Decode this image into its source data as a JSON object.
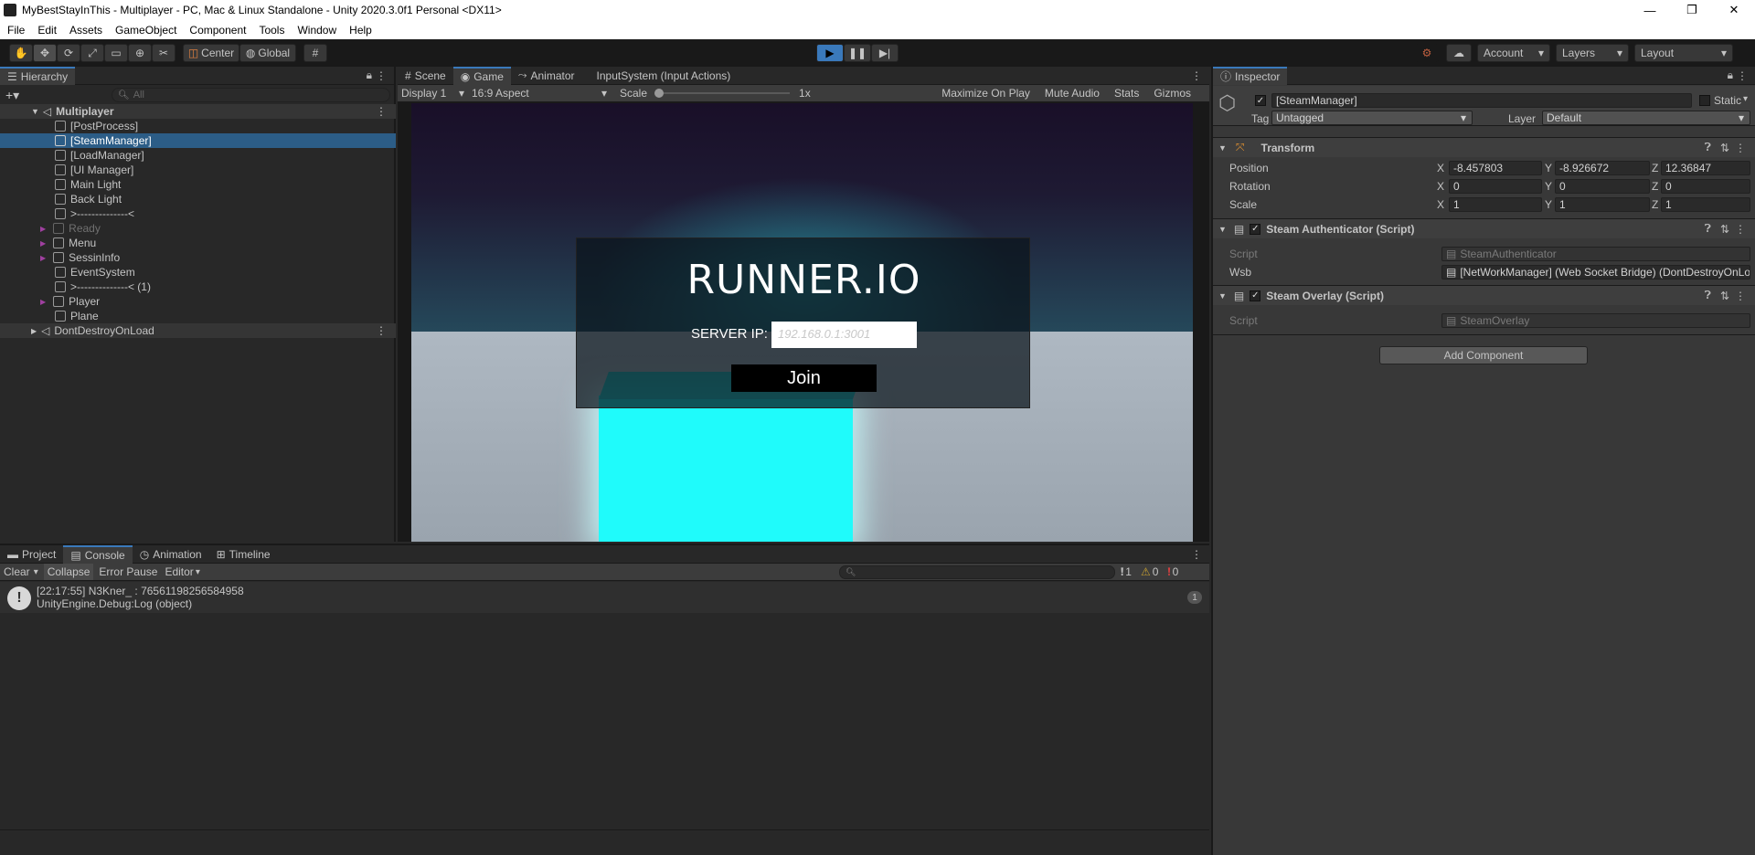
{
  "window": {
    "title": "MyBestStayInThis - Multiplayer - PC, Mac & Linux Standalone - Unity 2020.3.0f1 Personal <DX11>",
    "controls": {
      "minimize": "—",
      "restore": "❐",
      "close": "✕"
    }
  },
  "menu": [
    "File",
    "Edit",
    "Assets",
    "GameObject",
    "Component",
    "Tools",
    "Window",
    "Help"
  ],
  "toolbar": {
    "pivot": "Center",
    "space": "Global",
    "account": "Account",
    "layers": "Layers",
    "layout": "Layout"
  },
  "hierarchy": {
    "tab": "Hierarchy",
    "search_placeholder": "All",
    "scene": "Multiplayer",
    "items": [
      {
        "label": "[PostProcess]"
      },
      {
        "label": "[SteamManager]"
      },
      {
        "label": "[LoadManager]"
      },
      {
        "label": "[UI Manager]"
      },
      {
        "label": "Main Light"
      },
      {
        "label": "Back Light"
      },
      {
        "label": ">--------------<"
      },
      {
        "label": "Ready"
      },
      {
        "label": "Menu"
      },
      {
        "label": "SessinInfo"
      },
      {
        "label": "EventSystem"
      },
      {
        "label": ">--------------< (1)"
      },
      {
        "label": "Player"
      },
      {
        "label": "Plane"
      }
    ],
    "ddol": "DontDestroyOnLoad"
  },
  "game": {
    "tabs": [
      "Scene",
      "Game",
      "Animator",
      "InputSystem (Input Actions)"
    ],
    "display": "Display 1",
    "aspect": "16:9 Aspect",
    "scale_label": "Scale",
    "scale_value": "1x",
    "toggles": [
      "Maximize On Play",
      "Mute Audio",
      "Stats",
      "Gizmos"
    ],
    "ui": {
      "title": "RUNNER.IO",
      "server_label": "SERVER IP:",
      "server_placeholder": "192.168.0.1:3001",
      "join": "Join"
    }
  },
  "inspector": {
    "tab": "Inspector",
    "object_name": "[SteamManager]",
    "static": "Static",
    "tag_label": "Tag",
    "tag": "Untagged",
    "layer_label": "Layer",
    "layer": "Default",
    "transform": {
      "title": "Transform",
      "position_label": "Position",
      "rotation_label": "Rotation",
      "scale_label": "Scale",
      "axes": [
        "X",
        "Y",
        "Z"
      ],
      "position": [
        "-8.457803",
        "-8.926672",
        "12.36847"
      ],
      "rotation": [
        "0",
        "0",
        "0"
      ],
      "scale": [
        "1",
        "1",
        "1"
      ]
    },
    "steam_auth": {
      "title": "Steam Authenticator (Script)",
      "script_label": "Script",
      "script": "SteamAuthenticator",
      "wsb_label": "Wsb",
      "wsb": "[NetWorkManager] (Web Socket Bridge) (DontDestroyOnLoad)"
    },
    "steam_overlay": {
      "title": "Steam Overlay (Script)",
      "script_label": "Script",
      "script": "SteamOverlay"
    },
    "add_component": "Add Component"
  },
  "console": {
    "tabs": [
      "Project",
      "Console",
      "Animation",
      "Timeline"
    ],
    "buttons": [
      "Clear",
      "Collapse",
      "Error Pause",
      "Editor"
    ],
    "counts": {
      "info": "1",
      "warn": "0",
      "error": "0"
    },
    "log": {
      "line1": "[22:17:55] N3Kner_ : 76561198256584958",
      "line2": "UnityEngine.Debug:Log (object)",
      "count": "1"
    }
  }
}
